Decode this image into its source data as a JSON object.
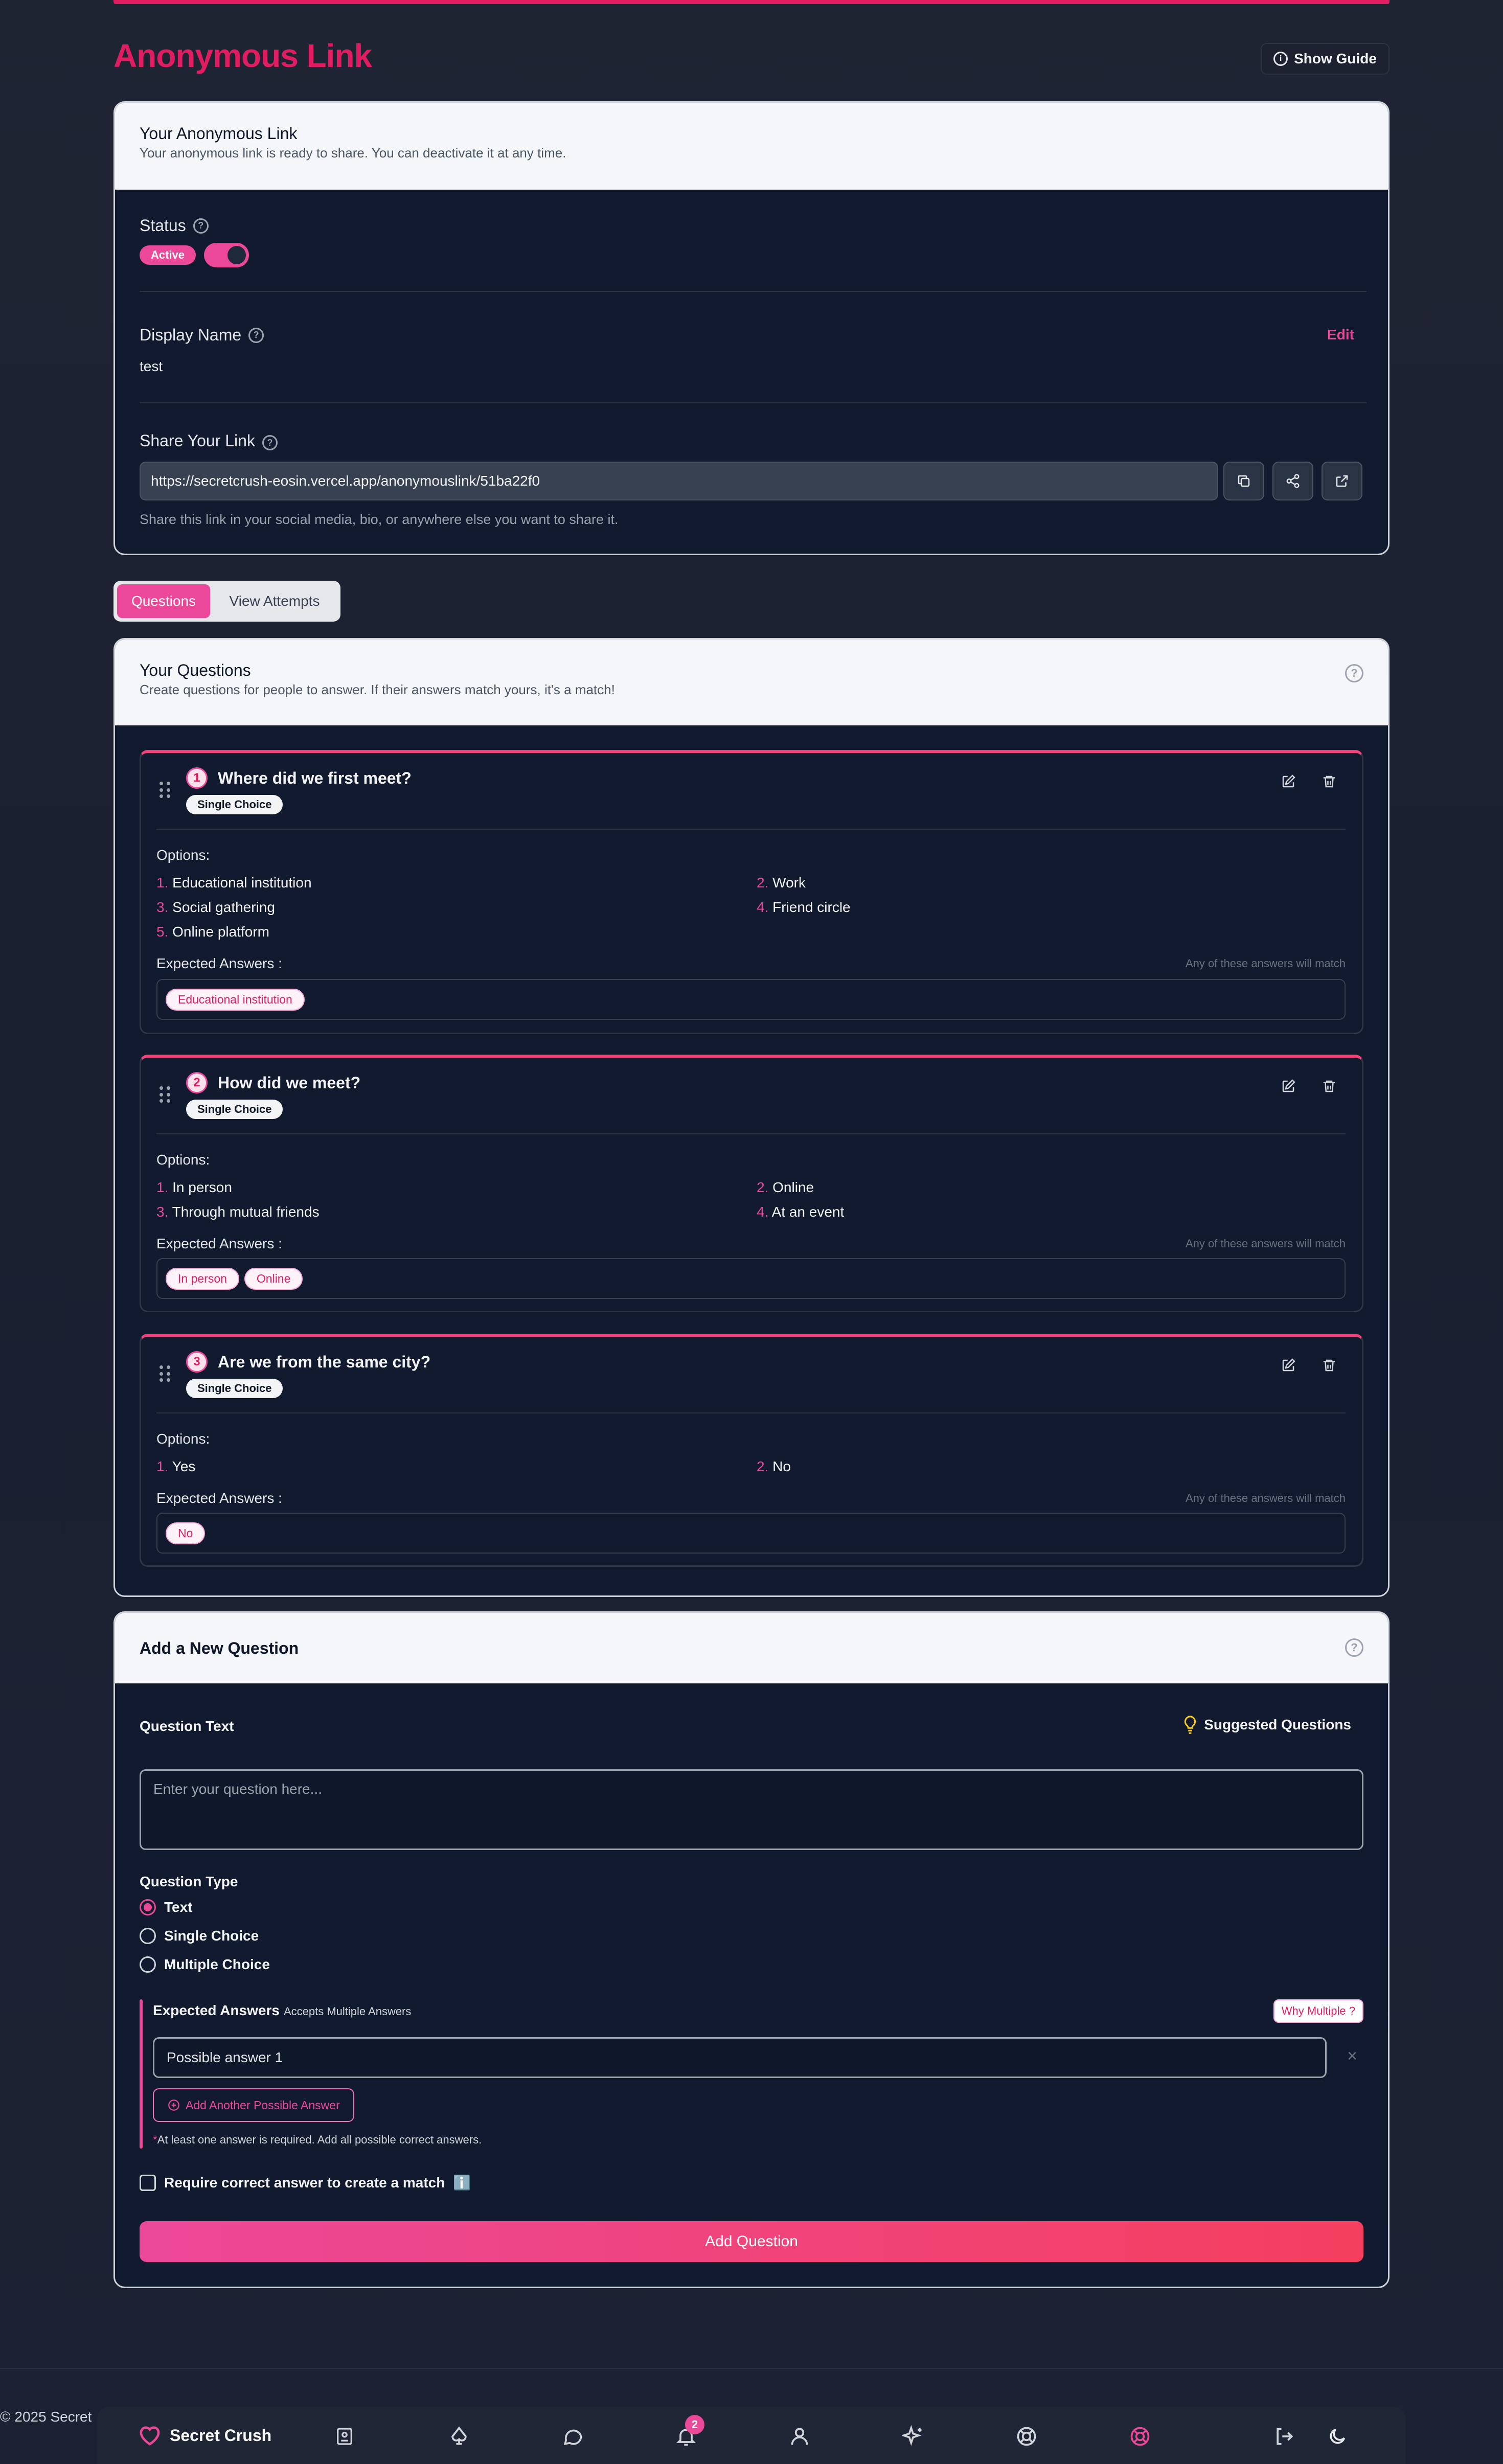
{
  "page": {
    "title": "Anonymous Link",
    "guide_button": "Show Guide"
  },
  "link_card": {
    "title": "Your Anonymous Link",
    "subtitle": "Your anonymous link is ready to share. You can deactivate it at any time.",
    "status_label": "Status",
    "status_value": "Active",
    "status_on": true,
    "display_name_label": "Display Name",
    "display_name_value": "test",
    "edit_label": "Edit",
    "share_label": "Share Your Link",
    "share_url": "https://secretcrush-eosin.vercel.app/anonymouslink/51ba22f0",
    "share_hint": "Share this link in your social media, bio, or anywhere else you want to share it."
  },
  "tabs": [
    {
      "label": "Questions",
      "active": true
    },
    {
      "label": "View Attempts",
      "active": false
    }
  ],
  "questions_card": {
    "title": "Your Questions",
    "subtitle": "Create questions for people to answer. If their answers match yours, it's a match!",
    "options_label": "Options:",
    "expected_label": "Expected Answers :",
    "expected_note": "Any of these answers will match",
    "questions": [
      {
        "num": "1",
        "title": "Where did we first meet?",
        "type": "Single Choice",
        "options": [
          "Educational institution",
          "Work",
          "Social gathering",
          "Friend circle",
          "Online platform"
        ],
        "expected": [
          "Educational institution"
        ]
      },
      {
        "num": "2",
        "title": "How did we meet?",
        "type": "Single Choice",
        "options": [
          "In person",
          "Online",
          "Through mutual friends",
          "At an event"
        ],
        "expected": [
          "In person",
          "Online"
        ]
      },
      {
        "num": "3",
        "title": "Are we from the same city?",
        "type": "Single Choice",
        "options": [
          "Yes",
          "No"
        ],
        "expected": [
          "No"
        ]
      }
    ]
  },
  "add_card": {
    "title": "Add a New Question",
    "question_text_label": "Question Text",
    "suggested_label": "Suggested Questions",
    "question_placeholder": "Enter your question here...",
    "question_type_label": "Question Type",
    "types": [
      {
        "label": "Text",
        "selected": true
      },
      {
        "label": "Single Choice",
        "selected": false
      },
      {
        "label": "Multiple Choice",
        "selected": false
      }
    ],
    "expected_label": "Expected Answers",
    "expected_sub": "Accepts Multiple Answers",
    "why_multiple": "Why Multiple ?",
    "answer_placeholder": "Possible answer 1",
    "add_answer_label": "Add Another Possible Answer",
    "required_note": "At least one answer is required. Add all possible correct answers.",
    "require_label": "Require correct answer to create a match",
    "require_info": "ℹ️",
    "submit_label": "Add Question"
  },
  "footer": {
    "copyright": "© 2025 Secret",
    "brand": "Secret Crush",
    "notifications_count": "2",
    "nav_icons": [
      "journal-icon",
      "spade-icon",
      "chat-icon",
      "bell-icon",
      "user-icon",
      "sparkles-icon",
      "help-buoy-icon",
      "crush-ring-icon",
      "logout-icon",
      "moon-icon"
    ]
  },
  "colors": {
    "accent": "#ec4899",
    "brand": "#e11d62",
    "background": "#1d2332",
    "card": "#111a2e"
  }
}
